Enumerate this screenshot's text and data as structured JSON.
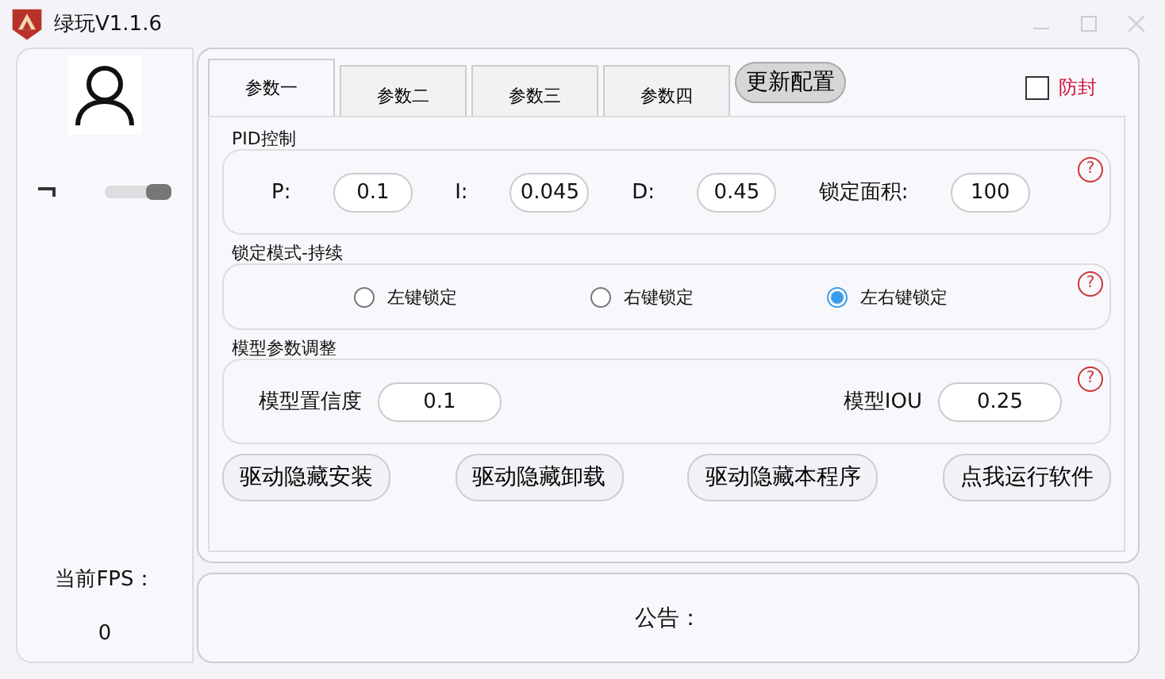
{
  "window": {
    "title": "绿玩V1.1.6"
  },
  "sidebar": {
    "fps_label": "当前FPS：",
    "fps_value": "0"
  },
  "tabs": [
    {
      "label": "参数一",
      "selected": true
    },
    {
      "label": "参数二",
      "selected": false
    },
    {
      "label": "参数三",
      "selected": false
    },
    {
      "label": "参数四",
      "selected": false
    }
  ],
  "update_button": "更新配置",
  "anti_ban": {
    "label": "防封",
    "checked": false
  },
  "pid": {
    "title": "PID控制",
    "fields": [
      {
        "label": "P:",
        "value": "0.1"
      },
      {
        "label": "I:",
        "value": "0.045"
      },
      {
        "label": "D:",
        "value": "0.45"
      },
      {
        "label": "锁定面积:",
        "value": "100"
      }
    ],
    "help": "?"
  },
  "lock_mode": {
    "title": "锁定模式-持续",
    "options": [
      {
        "label": "左键锁定",
        "selected": false
      },
      {
        "label": "右键锁定",
        "selected": false
      },
      {
        "label": "左右键锁定",
        "selected": true
      }
    ],
    "help": "?"
  },
  "model": {
    "title": "模型参数调整",
    "fields": [
      {
        "label": "模型置信度",
        "value": "0.1"
      },
      {
        "label": "模型IOU",
        "value": "0.25"
      }
    ],
    "help": "?"
  },
  "buttons": [
    "驱动隐藏安装",
    "驱动隐藏卸载",
    "驱动隐藏本程序",
    "点我运行软件"
  ],
  "notice": {
    "label": "公告："
  }
}
